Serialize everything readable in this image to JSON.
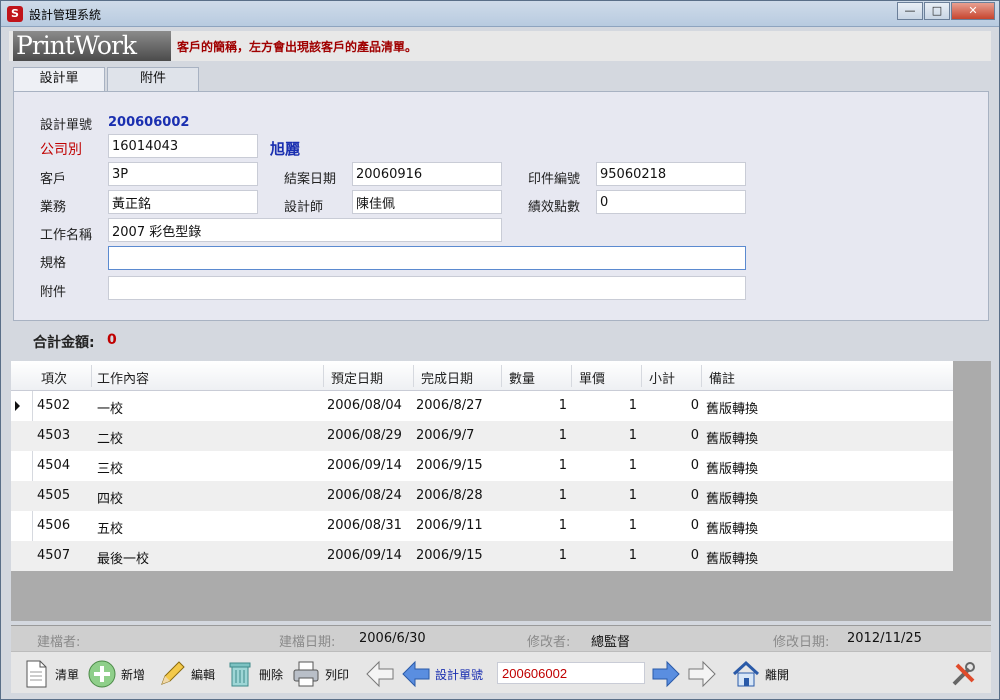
{
  "window": {
    "title": "設計管理系統",
    "app_icon": "S"
  },
  "header": {
    "logo": "PrintWork",
    "hint": "客戶的簡稱，左方會出現該客戶的產品清單。"
  },
  "tabs": [
    {
      "label": "設計單"
    },
    {
      "label": "附件"
    }
  ],
  "form": {
    "design_no_label": "設計單號",
    "design_no": "200606002",
    "company_label": "公司別",
    "company": "16014043",
    "company_name": "旭麗",
    "customer_label": "客戶",
    "customer": "3P",
    "close_date_label": "結案日期",
    "close_date": "20060916",
    "print_no_label": "印件編號",
    "print_no": "95060218",
    "sales_label": "業務",
    "sales": "黃正銘",
    "designer_label": "設計師",
    "designer": "陳佳佩",
    "points_label": "績效點數",
    "points": "0",
    "job_label": "工作名稱",
    "job": "2007 彩色型錄",
    "spec_label": "規格",
    "spec": "",
    "attach_label": "附件",
    "attach": ""
  },
  "total": {
    "label": "合計金額:",
    "value": "0"
  },
  "grid": {
    "columns": [
      "項次",
      "工作內容",
      "預定日期",
      "完成日期",
      "數量",
      "單價",
      "小計",
      "備註"
    ],
    "rows": [
      {
        "no": "4502",
        "content": "一校",
        "planned": "2006/08/04",
        "done": "2006/8/27",
        "qty": "1",
        "price": "1",
        "subtotal": "0",
        "note": "舊版轉換"
      },
      {
        "no": "4503",
        "content": "二校",
        "planned": "2006/08/29",
        "done": "2006/9/7",
        "qty": "1",
        "price": "1",
        "subtotal": "0",
        "note": "舊版轉換"
      },
      {
        "no": "4504",
        "content": "三校",
        "planned": "2006/09/14",
        "done": "2006/9/15",
        "qty": "1",
        "price": "1",
        "subtotal": "0",
        "note": "舊版轉換"
      },
      {
        "no": "4505",
        "content": "四校",
        "planned": "2006/08/24",
        "done": "2006/8/28",
        "qty": "1",
        "price": "1",
        "subtotal": "0",
        "note": "舊版轉換"
      },
      {
        "no": "4506",
        "content": "五校",
        "planned": "2006/08/31",
        "done": "2006/9/11",
        "qty": "1",
        "price": "1",
        "subtotal": "0",
        "note": "舊版轉換"
      },
      {
        "no": "4507",
        "content": "最後一校",
        "planned": "2006/09/14",
        "done": "2006/9/15",
        "qty": "1",
        "price": "1",
        "subtotal": "0",
        "note": "舊版轉換"
      }
    ]
  },
  "footer": {
    "creator_label": "建檔者:",
    "creator": "",
    "created_label": "建檔日期:",
    "created": "2006/6/30",
    "modifier_label": "修改者:",
    "modifier": "總監督",
    "modified_label": "修改日期:",
    "modified": "2012/11/25"
  },
  "toolbar": {
    "clear": "清單",
    "add": "新增",
    "edit": "編輯",
    "delete": "刪除",
    "print": "列印",
    "nav_label": "設計單號",
    "nav_value": "200606002",
    "exit": "離開"
  }
}
